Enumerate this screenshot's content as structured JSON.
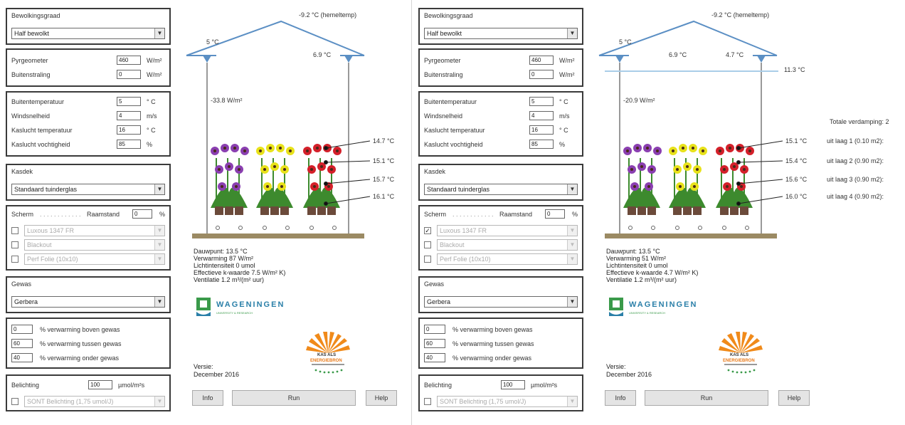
{
  "left": {
    "sky_title": "Bewolkingsgraad",
    "sky_value": "Half bewolkt",
    "pyrgeometer_label": "Pyrgeometer",
    "pyrgeometer_value": "460",
    "pyrgeometer_unit": "W/m²",
    "radiation_label": "Buitenstraling",
    "radiation_value": "0",
    "radiation_unit": "W/m²",
    "outside_temp_label": "Buitentemperatuur",
    "outside_temp_value": "5",
    "outside_temp_unit": "° C",
    "wind_label": "Windsnelheid",
    "wind_value": "4",
    "wind_unit": "m/s",
    "greenhouse_temp_label": "Kaslucht temperatuur",
    "greenhouse_temp_value": "16",
    "greenhouse_temp_unit": "° C",
    "humidity_label": "Kaslucht vochtigheid",
    "humidity_value": "85",
    "humidity_unit": "%",
    "glass_title": "Kasdek",
    "glass_value": "Standaard tuinderglas",
    "screen_label": "Scherm",
    "window_label": "Raamstand",
    "window_value": "0",
    "window_unit": "%",
    "screens": [
      {
        "name": "Luxous 1347 FR",
        "checked": ""
      },
      {
        "name": "Blackout",
        "checked": ""
      },
      {
        "name": "Perf Folie (10x10)",
        "checked": ""
      }
    ],
    "crop_title": "Gewas",
    "crop_value": "Gerbera",
    "heat_above_value": "0",
    "heat_above_label": "% verwarming boven gewas",
    "heat_between_value": "60",
    "heat_between_label": "% verwarming tussen gewas",
    "heat_below_value": "40",
    "heat_below_label": "% verwarming onder gewas",
    "lighting_label": "Belichting",
    "lighting_value": "100",
    "lighting_unit": "µmol/m²s",
    "lighting_lamp": "SONT Belichting (1,75 umol/J)",
    "sky_temp": "-9.2 °C (hemeltemp)",
    "roof_left_temp": "5 °C",
    "roof_right_temp": "6.9 °C",
    "screen_temp": "",
    "mid_temp": "",
    "radiation_flux": "-33.8 W/m²",
    "layer_temps": [
      "14.7 °C",
      "15.1 °C",
      "15.7 °C",
      "16.1 °C"
    ],
    "evaporation_title": "",
    "layer_evaps": [],
    "dew_point": "Dauwpunt: 13.5 °C",
    "heating": "Verwarming 87 W/m²",
    "light_intensity": "Lichtintensiteit 0 umol",
    "k_value": "Effectieve k-waarde 7.5 W/m² K)",
    "ventilation": "Ventilatie 1.2 m³/(m² uur)",
    "version_label": "Versie:",
    "version_date": "December 2016",
    "info_button": "Info",
    "run_button": "Run",
    "help_button": "Help"
  },
  "right": {
    "sky_title": "Bewolkingsgraad",
    "sky_value": "Half bewolkt",
    "pyrgeometer_label": "Pyrgeometer",
    "pyrgeometer_value": "460",
    "pyrgeometer_unit": "W/m²",
    "radiation_label": "Buitenstraling",
    "radiation_value": "0",
    "radiation_unit": "W/m²",
    "outside_temp_label": "Buitentemperatuur",
    "outside_temp_value": "5",
    "outside_temp_unit": "° C",
    "wind_label": "Windsnelheid",
    "wind_value": "4",
    "wind_unit": "m/s",
    "greenhouse_temp_label": "Kaslucht temperatuur",
    "greenhouse_temp_value": "16",
    "greenhouse_temp_unit": "° C",
    "humidity_label": "Kaslucht vochtigheid",
    "humidity_value": "85",
    "humidity_unit": "%",
    "glass_title": "Kasdek",
    "glass_value": "Standaard tuinderglas",
    "screen_label": "Scherm",
    "window_label": "Raamstand",
    "window_value": "0",
    "window_unit": "%",
    "screens": [
      {
        "name": "Luxous 1347 FR",
        "checked": "✓"
      },
      {
        "name": "Blackout",
        "checked": ""
      },
      {
        "name": "Perf Folie (10x10)",
        "checked": ""
      }
    ],
    "crop_title": "Gewas",
    "crop_value": "Gerbera",
    "heat_above_value": "0",
    "heat_above_label": "% verwarming boven gewas",
    "heat_between_value": "60",
    "heat_between_label": "% verwarming tussen gewas",
    "heat_below_value": "40",
    "heat_below_label": "% verwarming onder gewas",
    "lighting_label": "Belichting",
    "lighting_value": "100",
    "lighting_unit": "µmol/m²s",
    "lighting_lamp": "SONT Belichting (1,75 umol/J)",
    "sky_temp": "-9.2 °C (hemeltemp)",
    "roof_left_temp": "5 °C",
    "roof_right_temp": "4.7 °C",
    "screen_temp": "11.3 °C",
    "mid_temp": "6.9 °C",
    "radiation_flux": "-20.9 W/m²",
    "layer_temps": [
      "15.1 °C",
      "15.4 °C",
      "15.6 °C",
      "16.0 °C"
    ],
    "evaporation_title": "Totale verdamping: 2",
    "layer_evaps": [
      "uit laag 1 (0.10 m2):",
      "uit laag 2 (0.90 m2):",
      "uit laag 3 (0.90 m2):",
      "uit laag 4 (0.90 m2):"
    ],
    "dew_point": "Dauwpunt: 13.5 °C",
    "heating": "Verwarming 51 W/m²",
    "light_intensity": "Lichtintensiteit 0 umol",
    "k_value": "Effectieve k-waarde 4.7 W/m² K)",
    "ventilation": "Ventilatie 1.2 m³/(m² uur)",
    "version_label": "Versie:",
    "version_date": "December 2016",
    "info_button": "Info",
    "run_button": "Run",
    "help_button": "Help"
  },
  "logos": {
    "wageningen": "WAGENINGEN",
    "wageningen_sub": "UNIVERSITY & RESEARCH",
    "kas_top": "KAS ALS",
    "kas_bottom": "ENERGIEBRON"
  },
  "colors": {
    "frame": "#3a3a3a",
    "roof": "#5b8fc4",
    "screen_line": "#a9cde8",
    "floor": "#9b8a63",
    "flower_purple": "#8a3fb0",
    "flower_yellow": "#e8e21a",
    "flower_red": "#d4202a",
    "leaf": "#3d8a2e",
    "pot": "#6b4a3a",
    "sun_orange": "#f08a1a",
    "wur_blue": "#2a7fa8",
    "wur_green": "#3a9a4a"
  }
}
